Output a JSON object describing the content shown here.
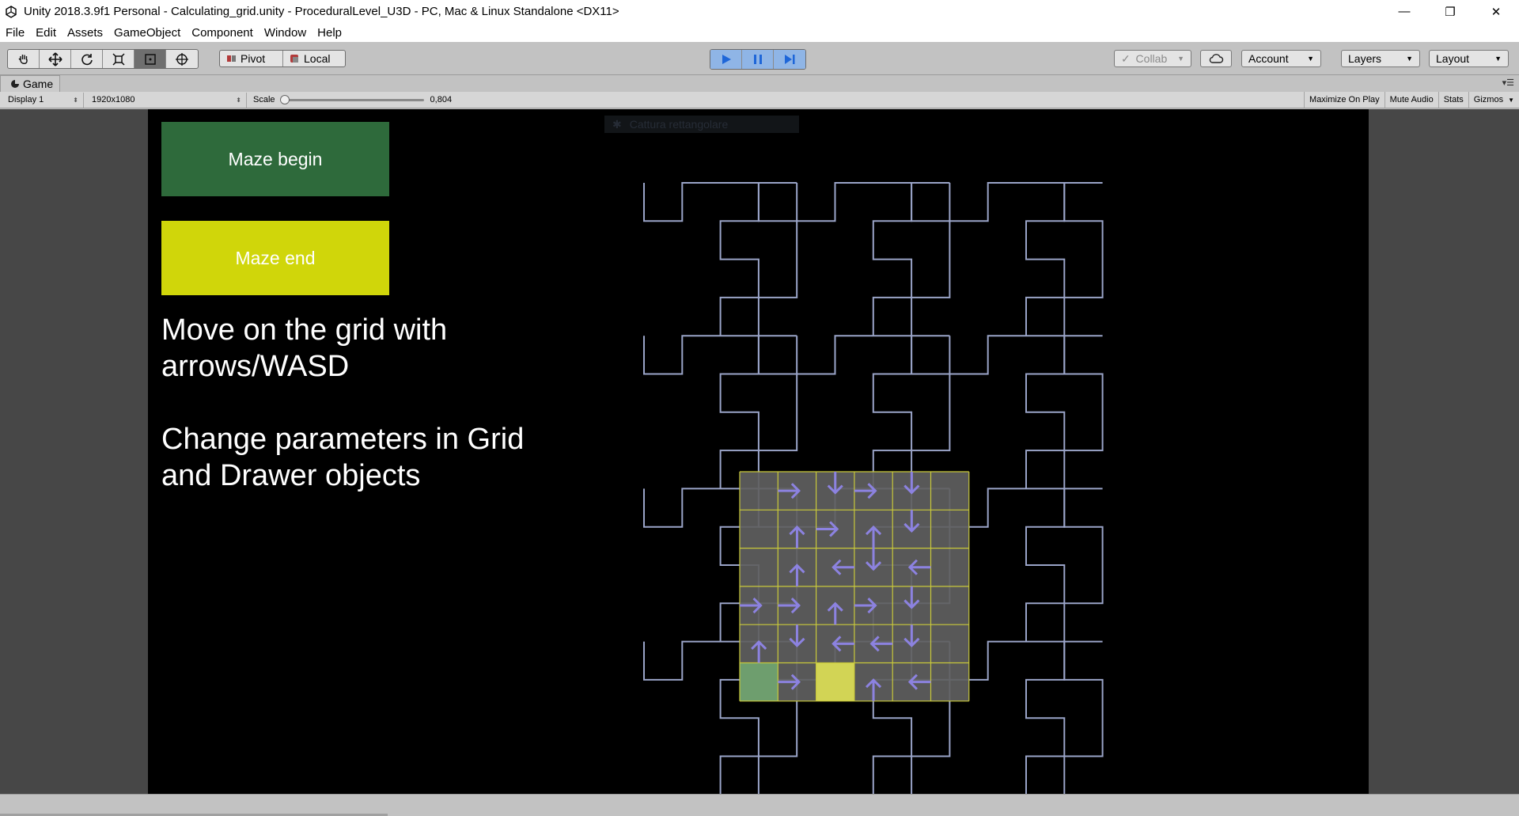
{
  "window": {
    "title": "Unity 2018.3.9f1 Personal - Calculating_grid.unity - ProceduralLevel_U3D - PC, Mac & Linux Standalone <DX11>",
    "minimize_glyph": "—",
    "restore_glyph": "❐",
    "close_glyph": "✕"
  },
  "menu": [
    "File",
    "Edit",
    "Assets",
    "GameObject",
    "Component",
    "Window",
    "Help"
  ],
  "toolbar": {
    "tools": [
      "hand-tool-icon",
      "move-tool-icon",
      "rotate-tool-icon",
      "scale-tool-icon",
      "rect-tool-icon",
      "transform-tool-icon"
    ],
    "active_tool": "rect-tool-icon",
    "pivot_label": "Pivot",
    "local_label": "Local",
    "collab_label": "Collab",
    "account_label": "Account",
    "layers_label": "Layers",
    "layout_label": "Layout",
    "play_active": true
  },
  "tab": {
    "label": "Game"
  },
  "game_toolbar": {
    "display": "Display 1",
    "resolution": "1920x1080",
    "scale_label": "Scale",
    "scale_value": "0,804",
    "scale_fraction": 0.0,
    "maximize_on_play": "Maximize On Play",
    "mute_audio": "Mute Audio",
    "stats": "Stats",
    "gizmos": "Gizmos"
  },
  "game": {
    "ghost_overlay_text": "Cattura rettangolare",
    "maze_begin_label": "Maze begin",
    "maze_end_label": "Maze end",
    "instructions": [
      "Move on the grid with arrows/WASD",
      "Change parameters in Grid and Drawer objects"
    ],
    "colors": {
      "begin": "#2e6a3b",
      "end": "#d0d60a",
      "maze_line": "#9aa4c8",
      "grid_line": "#c9c93a",
      "grid_fill": "#5f5f5f",
      "arrow": "#8c82e0",
      "start_cell": "#6e9e6e",
      "goal_cell": "#d2d455"
    },
    "grid": {
      "cols": 6,
      "rows": 6,
      "start_cell": [
        0,
        5
      ],
      "goal_cell": [
        2,
        5
      ],
      "arrows": [
        [
          "",
          "right",
          "down",
          "right",
          "down",
          ""
        ],
        [
          "",
          "up",
          "right",
          "up",
          "down",
          ""
        ],
        [
          "",
          "up",
          "left",
          "down",
          "left",
          ""
        ],
        [
          "right",
          "right",
          "up",
          "right",
          "down",
          ""
        ],
        [
          "up",
          "down",
          "left",
          "left",
          "down",
          ""
        ],
        [
          "",
          "right",
          "",
          "up",
          "left",
          ""
        ]
      ]
    }
  }
}
